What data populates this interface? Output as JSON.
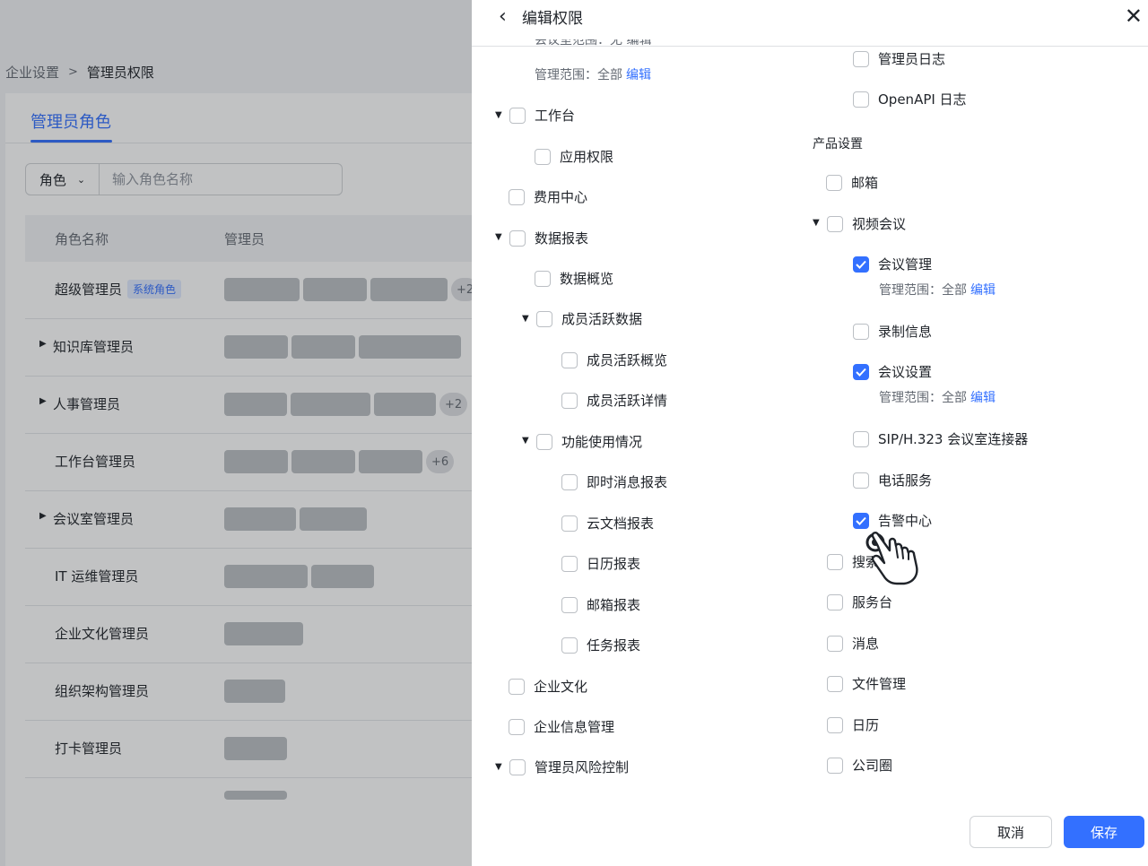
{
  "breadcrumb": {
    "parent": "企业设置",
    "current": "管理员权限"
  },
  "tabs": {
    "active": "管理员角色"
  },
  "search": {
    "select_label": "角色",
    "placeholder": "输入角色名称"
  },
  "table": {
    "headers": [
      "角色名称",
      "管理员"
    ],
    "rows": [
      {
        "name": "超级管理员",
        "badge": "系统角色",
        "more": "+2"
      },
      {
        "name": "知识库管理员"
      },
      {
        "name": "人事管理员",
        "more": "+2"
      },
      {
        "name": "工作台管理员",
        "more": "+6"
      },
      {
        "name": "会议室管理员"
      },
      {
        "name": "IT 运维管理员"
      },
      {
        "name": "企业文化管理员"
      },
      {
        "name": "组织架构管理员"
      },
      {
        "name": "打卡管理员"
      }
    ]
  },
  "drawer": {
    "title": "编辑权限",
    "cut_text": "会议室范围：无 编辑",
    "scope_label": "管理范围：",
    "scope_value": "全部",
    "edit_link": "编辑",
    "left_items": [
      "工作台",
      "应用权限",
      "费用中心",
      "数据报表",
      "数据概览",
      "成员活跃数据",
      "成员活跃概览",
      "成员活跃详情",
      "功能使用情况",
      "即时消息报表",
      "云文档报表",
      "日历报表",
      "邮箱报表",
      "任务报表",
      "企业文化",
      "企业信息管理",
      "管理员风险控制"
    ],
    "right_items": [
      "管理员日志",
      "OpenAPI 日志",
      "搜索",
      "服务台",
      "消息",
      "文件管理",
      "日历",
      "公司圈"
    ],
    "panel": {
      "title": "产品设置",
      "items": [
        "邮箱",
        "视频会议",
        "会议管理",
        "录制信息",
        "会议设置",
        "SIP/H.323 会议室连接器",
        "电话服务",
        "告警中心"
      ],
      "checked": [
        "会议管理",
        "会议设置",
        "告警中心"
      ]
    },
    "buttons": {
      "cancel": "取消",
      "save": "保存"
    }
  },
  "colors": {
    "accent": "#3370ff",
    "mask": "rgba(31,35,41,0.28)"
  },
  "icons": {
    "back": "chevron-left-icon",
    "close": "close-icon",
    "cursor": "hand-pointer-icon"
  }
}
